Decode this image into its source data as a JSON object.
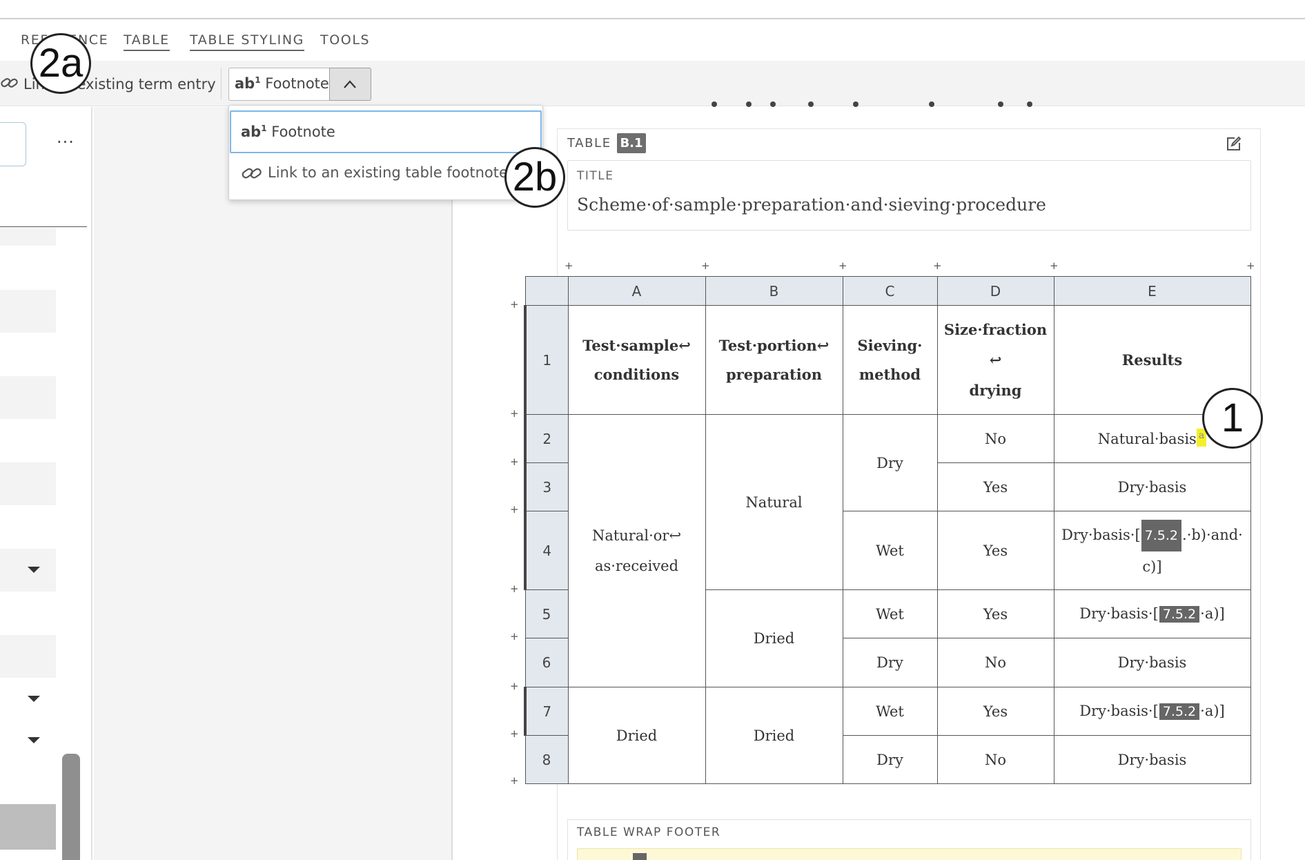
{
  "menu": {
    "reference": "REFERENCE",
    "table": "TABLE",
    "table_styling": "TABLE STYLING",
    "tools": "TOOLS"
  },
  "toolbar": {
    "link_term": "Link to existing term entry",
    "footnote": "Footnote",
    "footnote_prefix": "ab",
    "footnote_sup": "1"
  },
  "dropdown": {
    "item_footnote": "Footnote",
    "item_link": "Link to an existing table footnote"
  },
  "left_panel": {
    "more": "···"
  },
  "table_wrap": {
    "label": "TABLE",
    "number": "B.1",
    "title_label": "TITLE",
    "title": "Scheme·of·sample·preparation·and·sieving·procedure",
    "footer_label": "TABLE WRAP FOOTER"
  },
  "table": {
    "columns": [
      "A",
      "B",
      "C",
      "D",
      "E"
    ],
    "rows": [
      "1",
      "2",
      "3",
      "4",
      "5",
      "6",
      "7",
      "8"
    ],
    "header": {
      "a": [
        "Test·sample↩",
        "conditions"
      ],
      "b": [
        "Test·portion↩",
        "preparation"
      ],
      "c": [
        "Sieving·",
        "method"
      ],
      "d": [
        "Size·fraction",
        "↩",
        "drying"
      ],
      "e": "Results"
    },
    "cells": {
      "a_natural": [
        "Natural·or↩",
        "as·received"
      ],
      "a_dried": "Dried",
      "b_natural": "Natural",
      "b_dried1": "Dried",
      "b_dried2": "Dried",
      "c_dry1": "Dry",
      "c_wet4": "Wet",
      "c_wet5": "Wet",
      "c_dry6": "Dry",
      "c_wet7": "Wet",
      "c_dry8": "Dry",
      "d2": "No",
      "d3": "Yes",
      "d4": "Yes",
      "d5": "Yes",
      "d6": "No",
      "d7": "Yes",
      "d8": "No",
      "e2": "Natural·basis",
      "e2_mark": "a",
      "e3": "Dry·basis",
      "e4_pre": "Dry·basis·[",
      "e4_ref": "7.5.2",
      "e4_post": ".·b)·and·",
      "e4_post2": "c)]",
      "e5_pre": "Dry·basis·[",
      "e5_ref": "7.5.2",
      "e5_post": "·a)]",
      "e6": "Dry·basis",
      "e7_pre": "Dry·basis·[",
      "e7_ref": "7.5.2",
      "e7_post": "·a)]",
      "e8": "Dry·basis"
    }
  },
  "callouts": {
    "one": "1",
    "two_a": "2a",
    "two_b": "2b"
  },
  "icons": [
    "link-icon",
    "chevron-up-icon",
    "edit-icon",
    "caret-down-icon",
    "more-icon"
  ]
}
